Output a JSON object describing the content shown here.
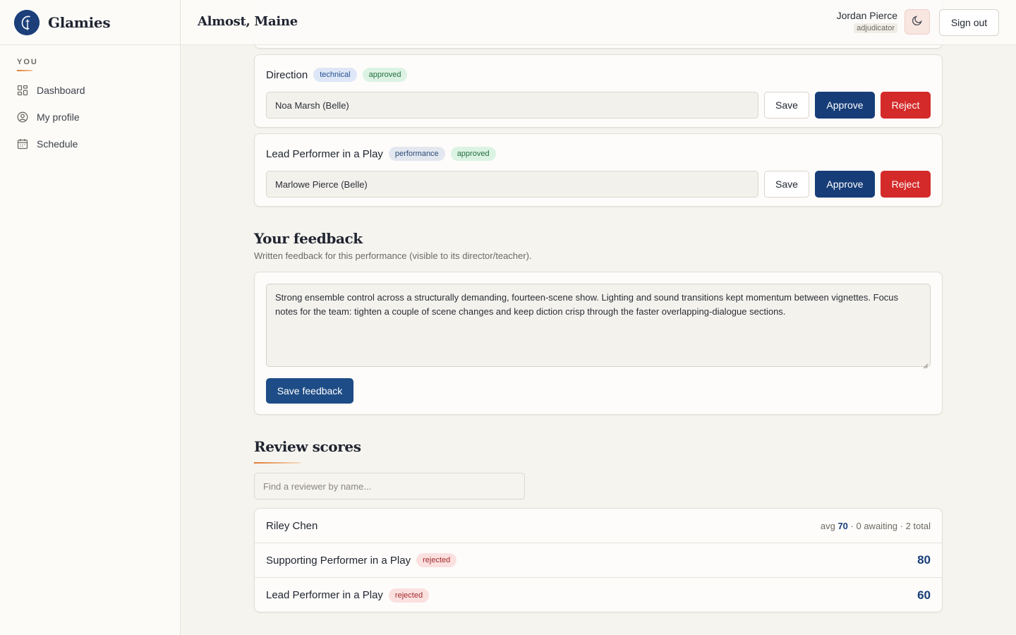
{
  "brand": {
    "name": "Glamies",
    "logo_letter": "G"
  },
  "sidebar": {
    "heading": "YOU",
    "items": [
      {
        "label": "Dashboard",
        "icon": "grid-icon"
      },
      {
        "label": "My profile",
        "icon": "user-circle-icon"
      },
      {
        "label": "Schedule",
        "icon": "calendar-icon"
      }
    ]
  },
  "header": {
    "title": "Almost, Maine",
    "user_name": "Jordan Pierce",
    "user_role": "adjudicator",
    "theme_icon": "moon-icon",
    "signout_label": "Sign out"
  },
  "awards": [
    {
      "title": "Direction",
      "category": "technical",
      "status": "approved",
      "value": "Noa Marsh (Belle)",
      "save_label": "Save",
      "approve_label": "Approve",
      "reject_label": "Reject"
    },
    {
      "title": "Lead Performer in a Play",
      "category": "performance",
      "status": "approved",
      "value": "Marlowe Pierce (Belle)",
      "save_label": "Save",
      "approve_label": "Approve",
      "reject_label": "Reject"
    }
  ],
  "feedback": {
    "title": "Your feedback",
    "subtitle": "Written feedback for this performance (visible to its director/teacher).",
    "text": "Strong ensemble control across a structurally demanding, fourteen-scene show. Lighting and sound transitions kept momentum between vignettes. Focus notes for the team: tighten a couple of scene changes and keep diction crisp through the faster overlapping-dialogue sections.",
    "save_label": "Save feedback"
  },
  "scores": {
    "title": "Review scores",
    "search_placeholder": "Find a reviewer by name...",
    "reviewer": {
      "name": "Riley Chen",
      "avg_label": "avg",
      "avg": "70",
      "summary": "· 0 awaiting · 2 total"
    },
    "rows": [
      {
        "category": "Supporting Performer in a Play",
        "status": "rejected",
        "score": "80"
      },
      {
        "category": "Lead Performer in a Play",
        "status": "rejected",
        "score": "60"
      }
    ]
  },
  "colors": {
    "primary": "#163d78",
    "danger": "#d42a2a",
    "accent": "#e07b2d",
    "background": "#f6f4ef"
  }
}
